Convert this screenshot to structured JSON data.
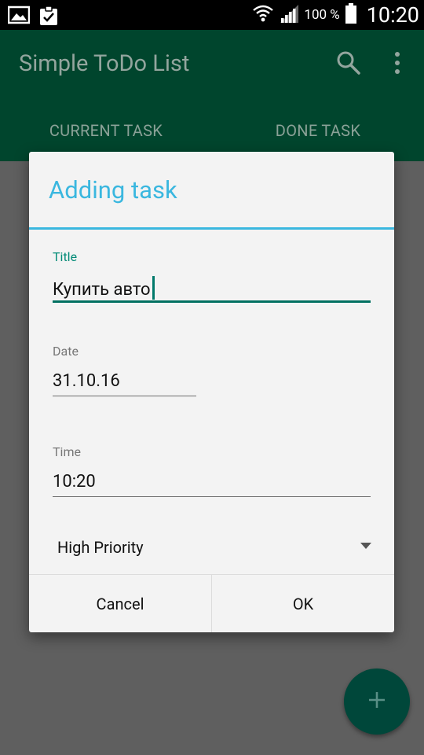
{
  "status_bar": {
    "battery_percent": "100 %",
    "clock": "10:20",
    "icons": [
      "image-icon",
      "clipboard-check-icon",
      "wifi-icon",
      "signal-icon",
      "battery-icon"
    ]
  },
  "app_bar": {
    "title": "Simple ToDo List",
    "tabs": [
      {
        "label": "CURRENT TASK"
      },
      {
        "label": "DONE TASK"
      }
    ]
  },
  "dialog": {
    "title": "Adding task",
    "fields": {
      "title": {
        "label": "Title",
        "value": "Купить авто"
      },
      "date": {
        "label": "Date",
        "value": "31.10.16"
      },
      "time": {
        "label": "Time",
        "value": "10:20"
      }
    },
    "priority": {
      "selected": "High Priority"
    },
    "buttons": {
      "cancel": "Cancel",
      "ok": "OK"
    }
  },
  "colors": {
    "accent": "#3ab7df",
    "primary_dark": "#00452d",
    "input_accent": "#007060"
  }
}
